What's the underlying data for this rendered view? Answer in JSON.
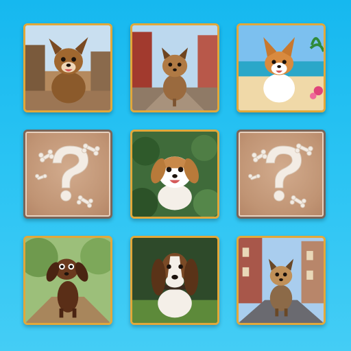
{
  "game": {
    "grid": {
      "rows": 3,
      "columns": 3
    },
    "cards": [
      {
        "position": 1,
        "state": "revealed",
        "image": "scruffy-brown-dog-on-old-town-street"
      },
      {
        "position": 2,
        "state": "revealed",
        "image": "yorkie-puppy-on-brick-street"
      },
      {
        "position": 3,
        "state": "revealed",
        "image": "corgi-on-tropical-beach"
      },
      {
        "position": 4,
        "state": "hidden",
        "image": "question-mark-bones-card-back"
      },
      {
        "position": 5,
        "state": "revealed",
        "image": "white-brown-beagle-in-foliage"
      },
      {
        "position": 6,
        "state": "hidden",
        "image": "question-mark-bones-card-back"
      },
      {
        "position": 7,
        "state": "revealed",
        "image": "dachshund-running-on-forest-path"
      },
      {
        "position": 8,
        "state": "revealed",
        "image": "basset-hound-in-grass"
      },
      {
        "position": 9,
        "state": "revealed",
        "image": "yorkie-on-city-street"
      }
    ],
    "colors": {
      "background": "#29c3f3",
      "face_card_border": "#e2a83a",
      "back_card_fill": "#c09474",
      "back_card_border": "#7a6558"
    }
  }
}
